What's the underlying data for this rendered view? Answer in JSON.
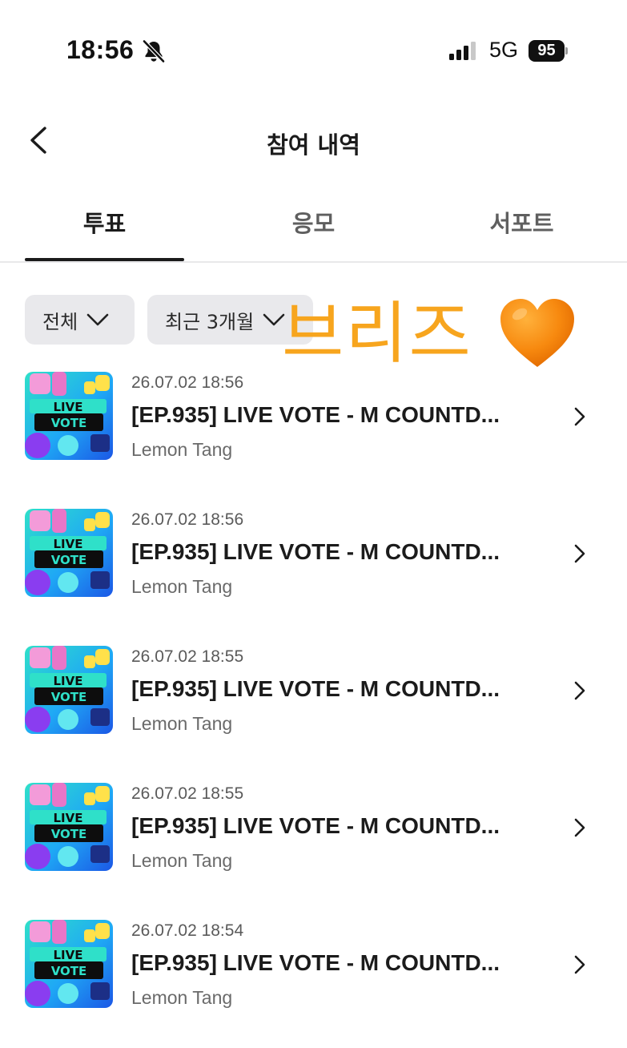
{
  "status_bar": {
    "time": "18:56",
    "network": "5G",
    "battery": "95"
  },
  "header": {
    "title": "참여 내역"
  },
  "tabs": [
    {
      "label": "투표",
      "active": true
    },
    {
      "label": "응모",
      "active": false
    },
    {
      "label": "서포트",
      "active": false
    }
  ],
  "filters": {
    "scope": "전체",
    "period": "최근 3개월"
  },
  "sticker": {
    "text": "브리즈",
    "emoji_icon": "orange-heart-icon",
    "color": "#f7a51e"
  },
  "thumbnail_text": {
    "line1": "LIVE",
    "line2": "VOTE"
  },
  "items": [
    {
      "date": "26.07.02 18:56",
      "title": "[EP.935] LIVE VOTE - M COUNTD...",
      "artist": "Lemon Tang"
    },
    {
      "date": "26.07.02 18:56",
      "title": "[EP.935] LIVE VOTE - M COUNTD...",
      "artist": "Lemon Tang"
    },
    {
      "date": "26.07.02 18:55",
      "title": "[EP.935] LIVE VOTE - M COUNTD...",
      "artist": "Lemon Tang"
    },
    {
      "date": "26.07.02 18:55",
      "title": "[EP.935] LIVE VOTE - M COUNTD...",
      "artist": "Lemon Tang"
    },
    {
      "date": "26.07.02 18:54",
      "title": "[EP.935] LIVE VOTE - M COUNTD...",
      "artist": "Lemon Tang"
    }
  ]
}
